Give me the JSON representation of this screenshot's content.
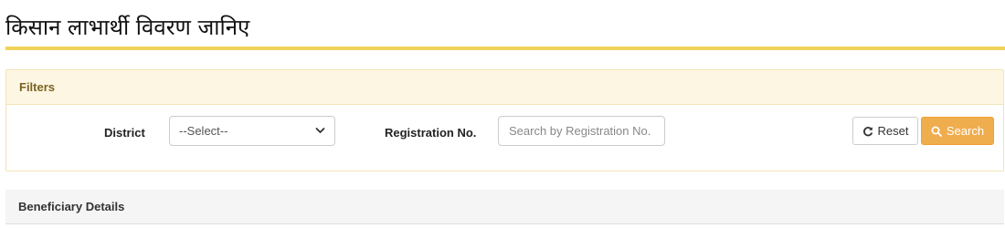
{
  "page": {
    "title": "किसान लाभार्थी विवरण जानिए"
  },
  "filters": {
    "heading": "Filters",
    "district": {
      "label": "District",
      "selected": "--Select--"
    },
    "registration": {
      "label": "Registration No.",
      "value": "",
      "placeholder": "Search by Registration No."
    },
    "reset_label": "Reset",
    "search_label": "Search",
    "colors": {
      "accent_rule": "#f1d35a",
      "search_button": "#f0ad4e",
      "panel_header": "#fdf6e2"
    }
  },
  "beneficiary": {
    "heading": "Beneficiary Details"
  },
  "icons": {
    "reset": "refresh-icon",
    "search": "search-icon",
    "select": "chevron-down-icon"
  }
}
